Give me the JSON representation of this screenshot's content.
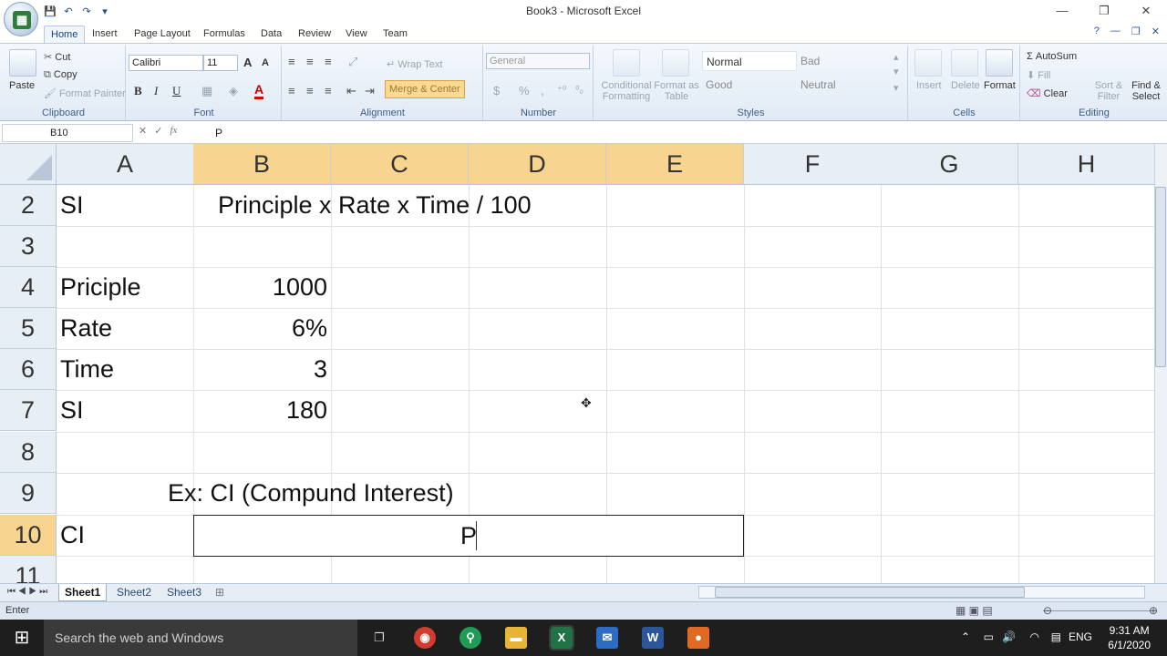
{
  "window": {
    "title": "Book3 - Microsoft Excel"
  },
  "qat": {
    "save": "💾",
    "undo": "↶",
    "redo": "↷",
    "more": "▾"
  },
  "ribbon_tabs": [
    "Home",
    "Insert",
    "Page Layout",
    "Formulas",
    "Data",
    "Review",
    "View",
    "Team"
  ],
  "clipboard": {
    "paste": "Paste",
    "cut": "Cut",
    "copy": "Copy",
    "format_painter": "Format Painter",
    "label": "Clipboard"
  },
  "font": {
    "name": "Calibri",
    "size": "11",
    "bold": "B",
    "italic": "I",
    "underline": "U",
    "label": "Font"
  },
  "alignment": {
    "wrap": "Wrap Text",
    "merge": "Merge & Center",
    "label": "Alignment"
  },
  "number": {
    "format": "General",
    "currency": "$",
    "percent": "%",
    "comma": ",",
    "label": "Number"
  },
  "styles": {
    "conditional": "Conditional Formatting",
    "format_table": "Format as Table",
    "normal": "Normal",
    "bad": "Bad",
    "good": "Good",
    "neutral": "Neutral",
    "label": "Styles"
  },
  "cells": {
    "insert": "Insert",
    "delete": "Delete",
    "format": "Format",
    "label": "Cells"
  },
  "editing": {
    "autosum": "AutoSum",
    "fill": "Fill",
    "clear": "Clear",
    "sort": "Sort & Filter",
    "find": "Find & Select",
    "label": "Editing"
  },
  "formula_bar": {
    "name_box": "B10",
    "fx": "fx",
    "value": "P"
  },
  "columns": [
    "A",
    "B",
    "C",
    "D",
    "E",
    "F",
    "G",
    "H"
  ],
  "rows": [
    "2",
    "3",
    "4",
    "5",
    "6",
    "7",
    "8",
    "9",
    "10",
    "11"
  ],
  "cells_data": {
    "a2": "SI",
    "b2": "Principle x Rate x Time / 100",
    "a4": "Priciple",
    "b4": "1000",
    "a5": "Rate",
    "b5": "6%",
    "a6": "Time",
    "b6": "3",
    "a7": "SI",
    "b7": "180",
    "b9": "Ex: CI (Compund Interest)",
    "a10": "CI",
    "b10": "P"
  },
  "sheets": [
    "Sheet1",
    "Sheet2",
    "Sheet3"
  ],
  "status": {
    "mode": "Enter"
  },
  "taskbar": {
    "search_placeholder": "Search the web and Windows",
    "lang": "ENG",
    "time": "9:31 AM",
    "date": "6/1/2020"
  }
}
